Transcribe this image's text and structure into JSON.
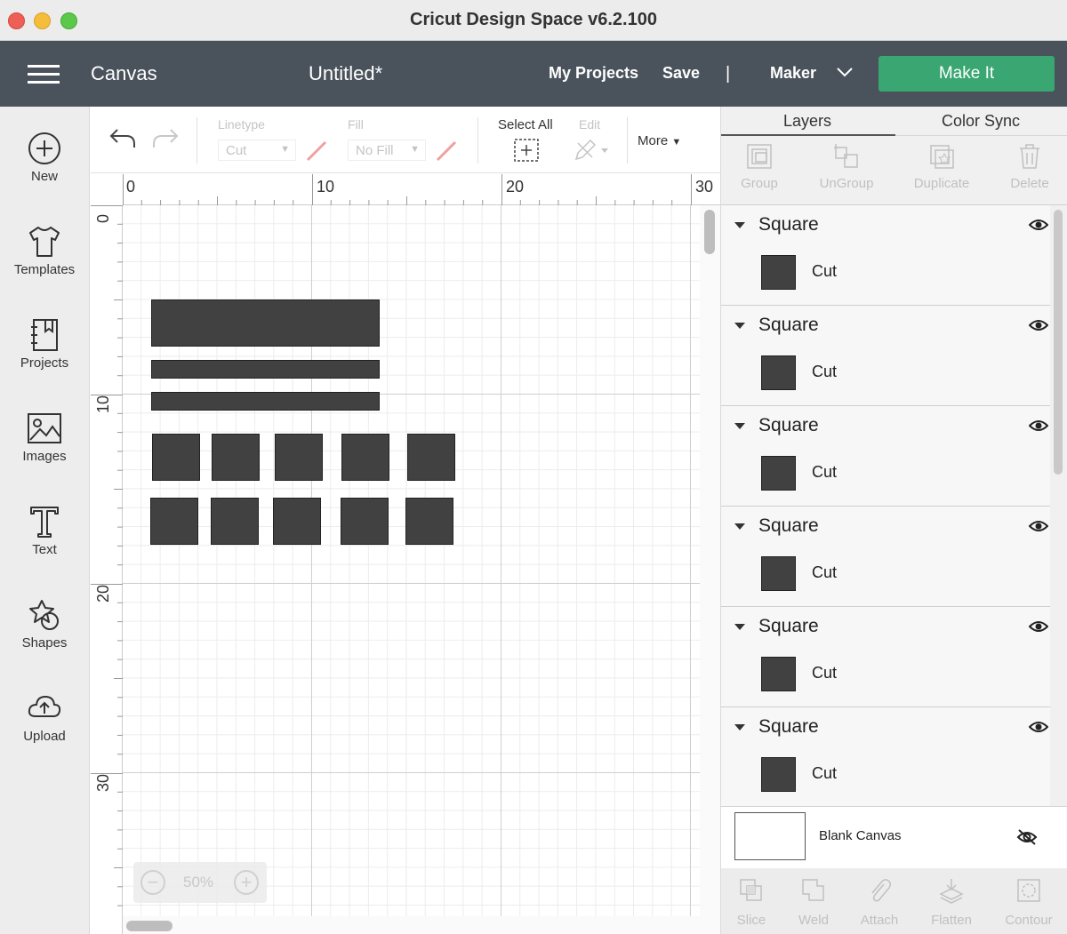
{
  "window": {
    "title": "Cricut Design Space  v6.2.100"
  },
  "header": {
    "section": "Canvas",
    "project_name": "Untitled*",
    "my_projects": "My Projects",
    "save": "Save",
    "separator": "|",
    "machine": "Maker",
    "make_it": "Make It"
  },
  "sidebar": {
    "items": [
      {
        "label": "New",
        "icon": "plus-circle-icon"
      },
      {
        "label": "Templates",
        "icon": "tshirt-icon"
      },
      {
        "label": "Projects",
        "icon": "notebook-icon"
      },
      {
        "label": "Images",
        "icon": "image-icon"
      },
      {
        "label": "Text",
        "icon": "text-t-icon"
      },
      {
        "label": "Shapes",
        "icon": "shapes-icon"
      },
      {
        "label": "Upload",
        "icon": "cloud-upload-icon"
      }
    ]
  },
  "toolbar": {
    "linetype_label": "Linetype",
    "linetype_value": "Cut",
    "fill_label": "Fill",
    "fill_value": "No Fill",
    "select_all": "Select All",
    "edit": "Edit",
    "more": "More"
  },
  "canvas": {
    "ruler_top": [
      "0",
      "10",
      "20",
      "30"
    ],
    "ruler_left": [
      "0",
      "10",
      "20",
      "30"
    ],
    "zoom": "50%",
    "zoom_out": "−",
    "zoom_in": "+"
  },
  "panel": {
    "tabs": [
      "Layers",
      "Color Sync"
    ],
    "actions": [
      "Group",
      "UnGroup",
      "Duplicate",
      "Delete"
    ],
    "layers": [
      {
        "name": "Square",
        "type": "Cut"
      },
      {
        "name": "Square",
        "type": "Cut"
      },
      {
        "name": "Square",
        "type": "Cut"
      },
      {
        "name": "Square",
        "type": "Cut"
      },
      {
        "name": "Square",
        "type": "Cut"
      },
      {
        "name": "Square",
        "type": "Cut"
      }
    ],
    "blank_canvas": "Blank Canvas",
    "bottom_actions": [
      "Slice",
      "Weld",
      "Attach",
      "Flatten",
      "Contour"
    ]
  },
  "colors": {
    "header": "#4a535c",
    "make_it": "#3aa672",
    "shape": "#414141"
  }
}
